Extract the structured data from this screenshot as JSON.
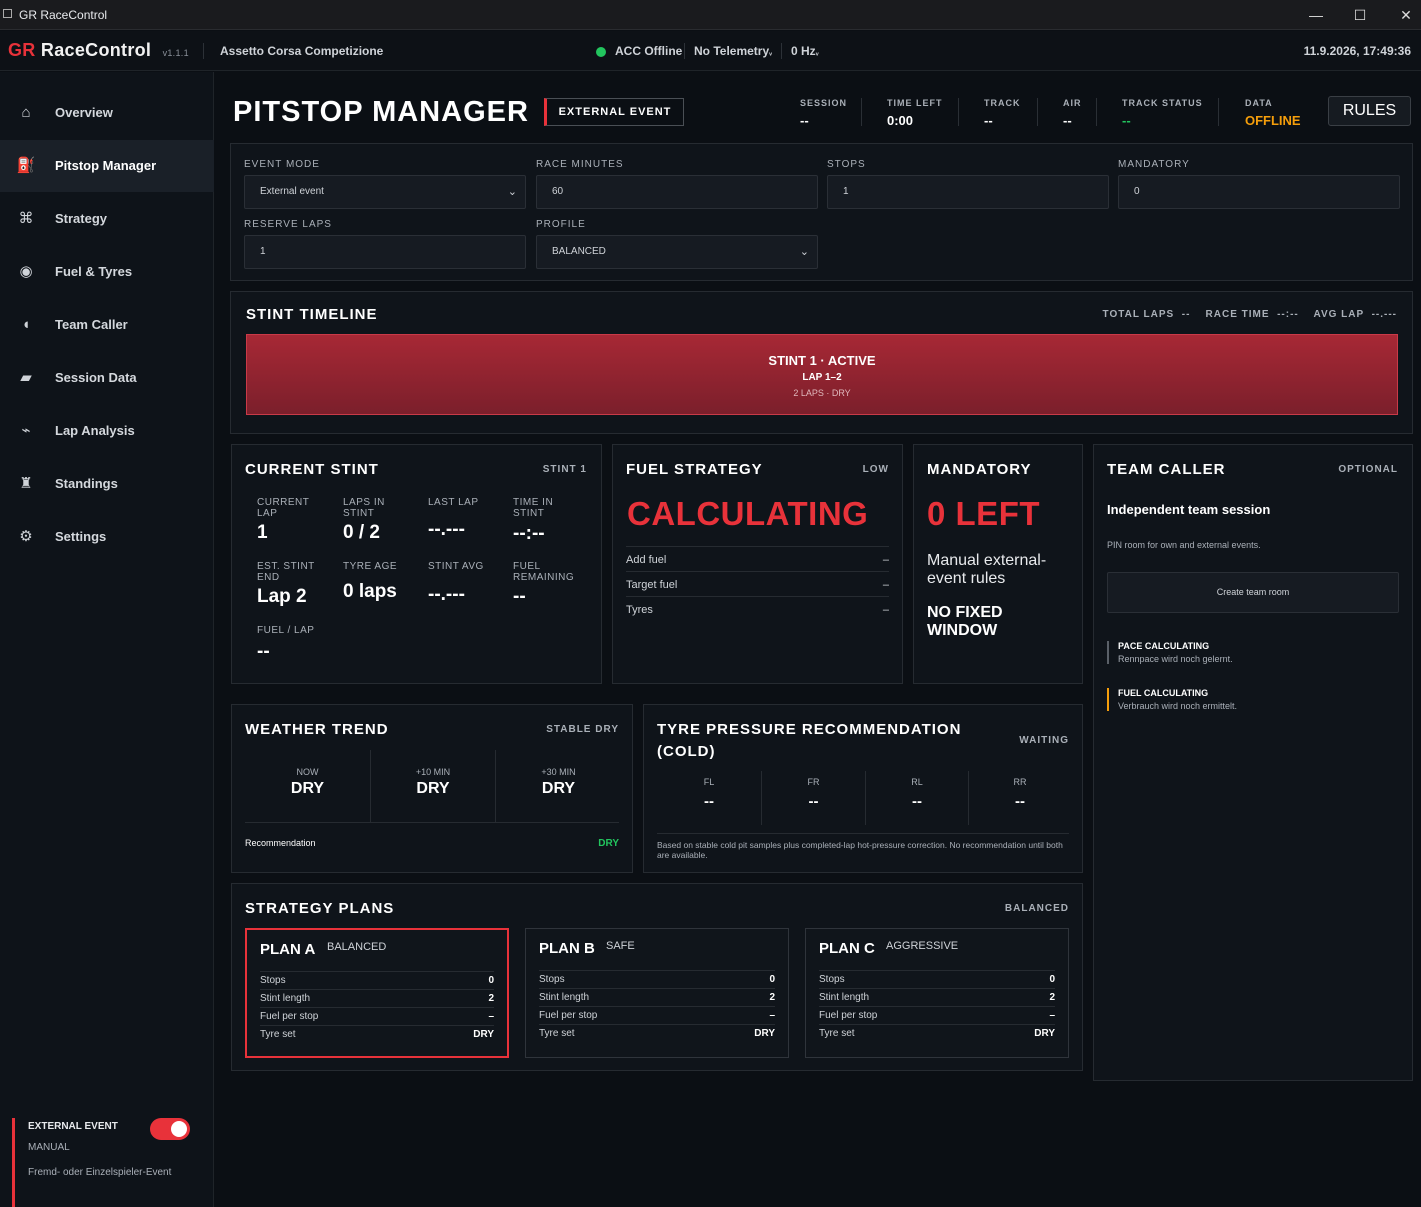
{
  "window": {
    "title": "GR RaceControl",
    "minimize": "—",
    "maximize": "☐",
    "close": "✕"
  },
  "appbar": {
    "brand_gr": "GR",
    "brand_name": "RaceControl",
    "version": "v1.1.1",
    "game": "Assetto Corsa Competizione",
    "acc_status": "ACC Offline",
    "telemetry": "No Telemetry",
    "hz": "0 Hz",
    "datetime": "11.9.2026, 17:49:36",
    "status_color": "#22c55e"
  },
  "sidebar": {
    "items": [
      {
        "label": "Overview",
        "icon": "⌂"
      },
      {
        "label": "Pitstop Manager",
        "icon": "⛽"
      },
      {
        "label": "Strategy",
        "icon": "⌘"
      },
      {
        "label": "Fuel & Tyres",
        "icon": "◉"
      },
      {
        "label": "Team Caller",
        "icon": "◖"
      },
      {
        "label": "Session Data",
        "icon": "▰"
      },
      {
        "label": "Lap Analysis",
        "icon": "⌁"
      },
      {
        "label": "Standings",
        "icon": "♜"
      },
      {
        "label": "Settings",
        "icon": "⚙"
      }
    ],
    "ext_title": "EXTERNAL EVENT",
    "ext_mode": "MANUAL",
    "ext_desc": "Fremd- oder Einzelspieler-Event",
    "ext_toggle_on": true
  },
  "header": {
    "title": "PITSTOP MANAGER",
    "badge": "EXTERNAL EVENT",
    "stats": [
      {
        "k": "SESSION",
        "v": "--"
      },
      {
        "k": "TIME LEFT",
        "v": "0:00"
      },
      {
        "k": "TRACK",
        "v": "--"
      },
      {
        "k": "AIR",
        "v": "--"
      },
      {
        "k": "TRACK STATUS",
        "v": "--"
      },
      {
        "k": "DATA",
        "v": "OFFLINE"
      }
    ],
    "rules_label": "RULES",
    "accent": "#e8323a",
    "offline_color": "#f59e0b"
  },
  "settings": {
    "event_mode_label": "EVENT MODE",
    "event_mode_value": "External event",
    "race_minutes_label": "RACE MINUTES",
    "race_minutes_value": "60",
    "stops_label": "STOPS",
    "stops_value": "1",
    "mandatory_label": "MANDATORY",
    "mandatory_value": "0",
    "reserve_laps_label": "RESERVE LAPS",
    "reserve_laps_value": "1",
    "profile_label": "PROFILE",
    "profile_value": "BALANCED"
  },
  "timeline": {
    "title": "STINT TIMELINE",
    "summary": "TOTAL LAPS  --    RACE TIME  --:--    AVG LAP  --.---",
    "stint_title": "STINT 1 · ACTIVE",
    "stint_laps": "LAP 1–2",
    "stint_sub": "2 LAPS · DRY"
  },
  "current_stint": {
    "title": "CURRENT STINT",
    "tag": "STINT 1",
    "fields": [
      {
        "k": "CURRENT\nLAP",
        "v": "1"
      },
      {
        "k": "LAPS IN\nSTINT",
        "v": "0 / 2"
      },
      {
        "k": "LAST LAP",
        "v": "--.---"
      },
      {
        "k": "TIME IN\nSTINT",
        "v": "--:--"
      },
      {
        "k": "EST. STINT\nEND",
        "v": "Lap 2"
      },
      {
        "k": "TYRE AGE",
        "v": "0 laps"
      },
      {
        "k": "STINT AVG",
        "v": "--.---"
      },
      {
        "k": "FUEL\nREMAINING",
        "v": "--"
      },
      {
        "k": "FUEL / LAP",
        "v": "--"
      }
    ]
  },
  "fuel_strategy": {
    "title": "FUEL STRATEGY",
    "tag": "LOW",
    "status": "CALCULATING",
    "rows": [
      {
        "k": "Add fuel",
        "v": "–"
      },
      {
        "k": "Target fuel",
        "v": "–"
      },
      {
        "k": "Tyres",
        "v": "–"
      }
    ]
  },
  "mandatory": {
    "title": "MANDATORY",
    "status": "0 LEFT",
    "desc": "Manual external-event rules",
    "window": "NO FIXED WINDOW"
  },
  "team_caller": {
    "title": "TEAM CALLER",
    "tag": "OPTIONAL",
    "heading": "Independent team session",
    "desc": "PIN room for own and external events.",
    "button": "Create team room",
    "notes": [
      {
        "h": "PACE CALCULATING",
        "s": "Rennpace wird noch gelernt.",
        "color": "#5a6068"
      },
      {
        "h": "FUEL CALCULATING",
        "s": "Verbrauch wird noch ermittelt.",
        "color": "#f59e0b"
      }
    ]
  },
  "weather": {
    "title": "WEATHER TREND",
    "tag": "STABLE DRY",
    "cols": [
      {
        "k": "NOW",
        "v": "DRY"
      },
      {
        "k": "+10 MIN",
        "v": "DRY"
      },
      {
        "k": "+30 MIN",
        "v": "DRY"
      }
    ],
    "rec_label": "Recommendation",
    "rec_value": "DRY",
    "rec_color": "#22c55e"
  },
  "tyre_pressure": {
    "title": "TYRE PRESSURE RECOMMENDATION (COLD)",
    "tag": "WAITING",
    "cols": [
      {
        "k": "FL",
        "v": "--"
      },
      {
        "k": "FR",
        "v": "--"
      },
      {
        "k": "RL",
        "v": "--"
      },
      {
        "k": "RR",
        "v": "--"
      }
    ],
    "note": "Based on stable cold pit samples plus completed-lap hot-pressure correction. No recommendation until both are available."
  },
  "plans": {
    "title": "STRATEGY PLANS",
    "tag": "BALANCED",
    "items": [
      {
        "name": "PLAN A",
        "type": "BALANCED",
        "selected": true,
        "rows": [
          {
            "k": "Stops",
            "v": "0"
          },
          {
            "k": "Stint length",
            "v": "2"
          },
          {
            "k": "Fuel per stop",
            "v": "–"
          },
          {
            "k": "Tyre set",
            "v": "DRY"
          }
        ]
      },
      {
        "name": "PLAN B",
        "type": "SAFE",
        "selected": false,
        "rows": [
          {
            "k": "Stops",
            "v": "0"
          },
          {
            "k": "Stint length",
            "v": "2"
          },
          {
            "k": "Fuel per stop",
            "v": "–"
          },
          {
            "k": "Tyre set",
            "v": "DRY"
          }
        ]
      },
      {
        "name": "PLAN C",
        "type": "AGGRESSIVE",
        "selected": false,
        "rows": [
          {
            "k": "Stops",
            "v": "0"
          },
          {
            "k": "Stint length",
            "v": "2"
          },
          {
            "k": "Fuel per stop",
            "v": "–"
          },
          {
            "k": "Tyre set",
            "v": "DRY"
          }
        ]
      }
    ]
  }
}
